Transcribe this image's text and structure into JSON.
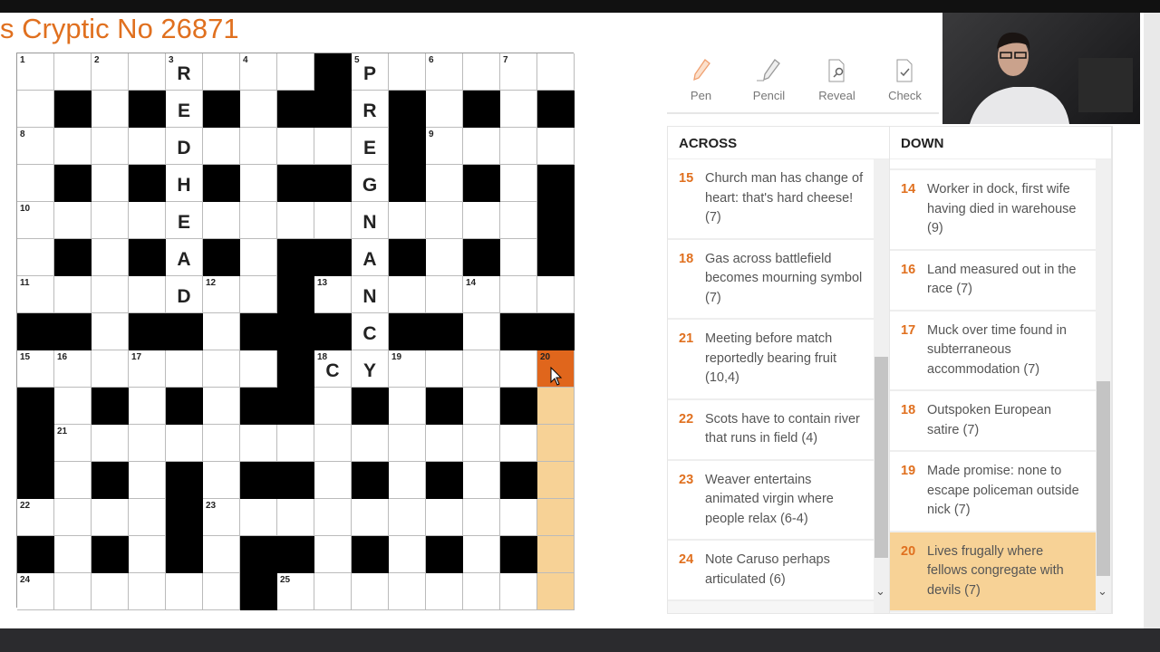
{
  "title": "s Cryptic No 26871",
  "grid": {
    "rows": [
      "........#......",
      ".#.#.#.##.#.#.#",
      "..........#....",
      ".#.#.#.##.#.#.#",
      "..............#",
      ".#.#.#.##.#.#.#",
      ".......#.......",
      "##.##.###.##.##",
      ".......#.......",
      "#.#.#.##.#.#.#.",
      "#..............",
      "#.#.#.##.#.#.#.",
      "....#..........",
      "#.#.#.##.#.#.#.",
      "......#........"
    ],
    "numbers": [
      [
        0,
        0,
        "1"
      ],
      [
        0,
        2,
        "2"
      ],
      [
        0,
        4,
        "3"
      ],
      [
        0,
        6,
        "4"
      ],
      [
        0,
        9,
        "5"
      ],
      [
        0,
        11,
        "6"
      ],
      [
        0,
        13,
        "7"
      ],
      [
        2,
        0,
        "8"
      ],
      [
        2,
        11,
        "9"
      ],
      [
        4,
        0,
        "10"
      ],
      [
        6,
        0,
        "11"
      ],
      [
        6,
        5,
        "12"
      ],
      [
        6,
        8,
        "13"
      ],
      [
        6,
        12,
        "14"
      ],
      [
        8,
        0,
        "15"
      ],
      [
        8,
        1,
        "16"
      ],
      [
        8,
        3,
        "17"
      ],
      [
        8,
        8,
        "18"
      ],
      [
        8,
        10,
        "19"
      ],
      [
        8,
        14,
        "20"
      ],
      [
        10,
        1,
        "21"
      ],
      [
        12,
        0,
        "22"
      ],
      [
        12,
        5,
        "23"
      ],
      [
        14,
        0,
        "24"
      ],
      [
        14,
        7,
        "25"
      ]
    ],
    "letters": [
      [
        0,
        4,
        "R"
      ],
      [
        1,
        4,
        "E"
      ],
      [
        2,
        4,
        "D"
      ],
      [
        3,
        4,
        "H"
      ],
      [
        4,
        4,
        "E"
      ],
      [
        5,
        4,
        "A"
      ],
      [
        6,
        4,
        "D"
      ],
      [
        0,
        9,
        "P"
      ],
      [
        1,
        9,
        "R"
      ],
      [
        2,
        9,
        "E"
      ],
      [
        3,
        9,
        "G"
      ],
      [
        4,
        9,
        "N"
      ],
      [
        5,
        9,
        "A"
      ],
      [
        6,
        9,
        "N"
      ],
      [
        7,
        9,
        "C"
      ],
      [
        8,
        9,
        "Y"
      ],
      [
        8,
        8,
        "C"
      ]
    ],
    "active_cell": [
      8,
      14
    ],
    "highlighted_clue": "20 down",
    "colors": {
      "active": "#e0661c",
      "highlight": "#f7d296"
    }
  },
  "toolbar": {
    "pen": "Pen",
    "pencil": "Pencil",
    "reveal": "Reveal",
    "check": "Check"
  },
  "across": {
    "heading": "ACROSS",
    "clues": [
      {
        "n": "15",
        "text": "Church man has change of heart: that's hard cheese! (7)"
      },
      {
        "n": "18",
        "text": "Gas across battlefield becomes mourning symbol (7)"
      },
      {
        "n": "21",
        "text": "Meeting before match reportedly bearing fruit (10,4)"
      },
      {
        "n": "22",
        "text": "Scots have to contain river that runs in field (4)"
      },
      {
        "n": "23",
        "text": "Weaver entertains animated virgin where people relax (6-4)"
      },
      {
        "n": "24",
        "text": "Note Caruso perhaps articulated (6)"
      }
    ]
  },
  "down": {
    "heading": "DOWN",
    "clues": [
      {
        "n": "14",
        "text": "Worker in dock, first wife having died in warehouse (9)"
      },
      {
        "n": "16",
        "text": "Land measured out in the race (7)"
      },
      {
        "n": "17",
        "text": "Muck over time found in subterraneous accommodation (7)"
      },
      {
        "n": "18",
        "text": "Outspoken European satire (7)"
      },
      {
        "n": "19",
        "text": "Made promise: none to escape policeman outside nick (7)"
      },
      {
        "n": "20",
        "text": "Lives frugally where fellows congregate with devils (7)",
        "selected": true
      }
    ]
  },
  "accent": "#e0701f"
}
